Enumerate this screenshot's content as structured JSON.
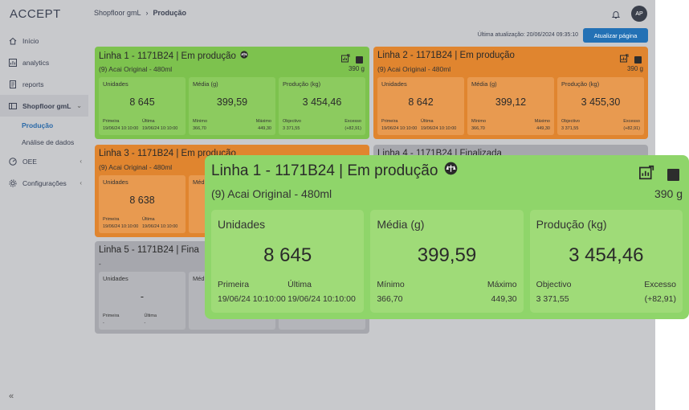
{
  "app": {
    "logo": "ACCEPT"
  },
  "sidebar": {
    "items": [
      {
        "label": "Início",
        "icon": "home-icon"
      },
      {
        "label": "analytics",
        "icon": "analytics-icon"
      },
      {
        "label": "reports",
        "icon": "reports-icon"
      },
      {
        "label": "Shopfloor gmL",
        "icon": "shopfloor-icon",
        "open": true,
        "children": [
          {
            "label": "Produção",
            "active": true
          },
          {
            "label": "Análise de dados"
          }
        ]
      },
      {
        "label": "OEE",
        "icon": "oee-icon"
      },
      {
        "label": "Configurações",
        "icon": "settings-icon"
      }
    ]
  },
  "header": {
    "breadcrumb": [
      "Shopfloor gmL",
      "Produção"
    ],
    "avatar": "AP",
    "last_update": "Última atualização: 20/06/2024 09:35:10",
    "refresh_label": "Atualizar página"
  },
  "colors": {
    "running": "#7dc24e",
    "warning": "#e0852f",
    "finished": "#a6a7ad",
    "accent": "#2371b5"
  },
  "cards": [
    {
      "title": "Linha 1 - 1171B24 | Em produção",
      "status": "running",
      "product": "(9) Acai Original - 480ml",
      "weight": "390 g",
      "units": {
        "label": "Unidades",
        "value": "8 645",
        "first_label": "Primeira",
        "first": "19/06/24 10:10:00",
        "last_label": "Última",
        "last": "19/06/24 10:10:00"
      },
      "avg": {
        "label": "Média (g)",
        "value": "399,59",
        "min_label": "Mínimo",
        "min": "366,70",
        "max_label": "Máximo",
        "max": "449,30"
      },
      "prod": {
        "label": "Produção (kg)",
        "value": "3 454,46",
        "obj_label": "Objectivo",
        "obj": "3 371,55",
        "exc_label": "Excesso",
        "exc": "(+82,91)"
      }
    },
    {
      "title": "Linha 2 - 1171B24 | Em produção",
      "status": "warning",
      "product": "(9) Acai Original - 480ml",
      "weight": "390 g",
      "units": {
        "label": "Unidades",
        "value": "8 642",
        "first_label": "Primeira",
        "first": "19/06/24 10:10:00",
        "last_label": "Última",
        "last": "19/06/24 10:10:00"
      },
      "avg": {
        "label": "Média (g)",
        "value": "399,12",
        "min_label": "Mínimo",
        "min": "366,70",
        "max_label": "Máximo",
        "max": "449,30"
      },
      "prod": {
        "label": "Produção (kg)",
        "value": "3 455,30",
        "obj_label": "Objectivo",
        "obj": "3 371,55",
        "exc_label": "Excesso",
        "exc": "(+82,91)"
      }
    },
    {
      "title": "Linha 3 - 1171B24 | Em produção",
      "status": "warning",
      "product": "(9) Acai Original - 480ml",
      "weight": "",
      "units": {
        "label": "Unidades",
        "value": "8 638",
        "first_label": "Primeira",
        "first": "19/06/24 10:10:00",
        "last_label": "Última",
        "last": "19/06/24 10:10:00"
      },
      "avg": {
        "label": "Méd",
        "value": "",
        "min_label": "",
        "min": "",
        "max_label": "",
        "max": ""
      },
      "prod": {
        "label": "",
        "value": "",
        "obj_label": "",
        "obj": "",
        "exc_label": "",
        "exc": ""
      }
    },
    {
      "title": "Linha 4 - 1171B24 | Finalizada",
      "status": "finished",
      "product": "",
      "weight": ""
    },
    {
      "title": "Linha 5 - 1171B24 | Fina",
      "status": "finished",
      "product": "-",
      "weight": "",
      "units": {
        "label": "Unidades",
        "value": "-",
        "first_label": "Primeira",
        "first": "-",
        "last_label": "Última",
        "last": "-"
      },
      "avg": {
        "label": "Méd",
        "value": "",
        "min_label": "",
        "min": "",
        "max_label": "",
        "max": ""
      },
      "prod": {
        "label": "",
        "value": "",
        "obj_label": "",
        "obj": "",
        "exc_label": "",
        "exc": ""
      }
    }
  ],
  "zoom": {
    "title": "Linha 1 - 1171B24 | Em produção",
    "product": "(9) Acai Original - 480ml",
    "weight": "390 g",
    "units": {
      "label": "Unidades",
      "value": "8 645",
      "first_label": "Primeira",
      "first": "19/06/24 10:10:00",
      "last_label": "Última",
      "last": "19/06/24 10:10:00"
    },
    "avg": {
      "label": "Média (g)",
      "value": "399,59",
      "min_label": "Mínimo",
      "min": "366,70",
      "max_label": "Máximo",
      "max": "449,30"
    },
    "prod": {
      "label": "Produção (kg)",
      "value": "3 454,46",
      "obj_label": "Objectivo",
      "obj": "3 371,55",
      "exc_label": "Excesso",
      "exc": "(+82,91)"
    }
  }
}
